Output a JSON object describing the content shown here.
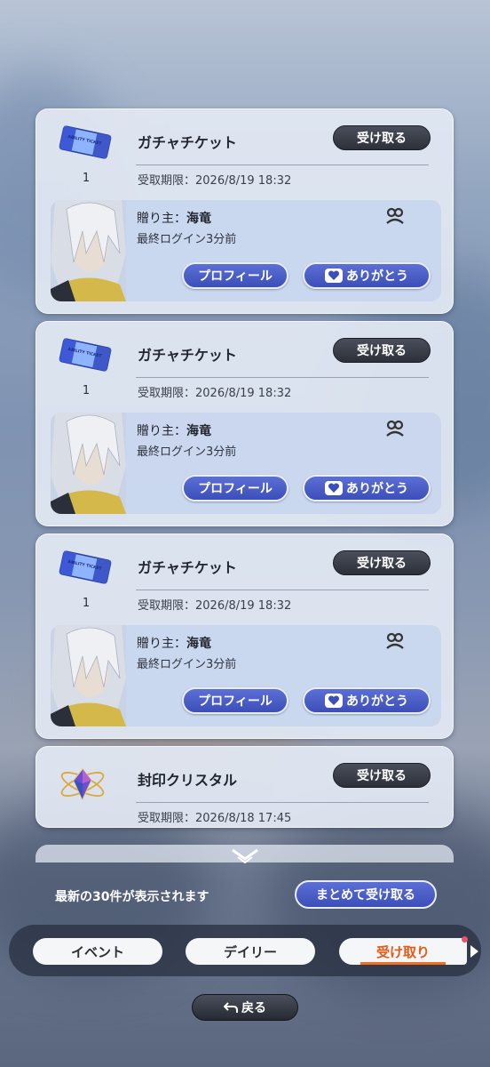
{
  "gifts": [
    {
      "name": "ガチャチケット",
      "qty": "1",
      "receive_label": "受け取る",
      "expiry": "受取期限：2026/8/19 18:32",
      "sender_prefix": "贈り主：",
      "sender_name": "海竜",
      "last_login": "最終ログイン3分前",
      "profile_label": "プロフィール",
      "thanks_label": "ありがとう",
      "ticket_text": "ABILITY TICKET"
    },
    {
      "name": "ガチャチケット",
      "qty": "1",
      "receive_label": "受け取る",
      "expiry": "受取期限：2026/8/19 18:32",
      "sender_prefix": "贈り主：",
      "sender_name": "海竜",
      "last_login": "最終ログイン3分前",
      "profile_label": "プロフィール",
      "thanks_label": "ありがとう",
      "ticket_text": "ABILITY TICKET"
    },
    {
      "name": "ガチャチケット",
      "qty": "1",
      "receive_label": "受け取る",
      "expiry": "受取期限：2026/8/19 18:32",
      "sender_prefix": "贈り主：",
      "sender_name": "海竜",
      "last_login": "最終ログイン3分前",
      "profile_label": "プロフィール",
      "thanks_label": "ありがとう",
      "ticket_text": "ABILITY TICKET"
    },
    {
      "name": "封印クリスタル",
      "receive_label": "受け取る",
      "expiry": "受取期限：2026/8/18 17:45"
    }
  ],
  "footer": {
    "notice": "最新の30件が表示されます",
    "bulk_receive_label": "まとめて受け取る"
  },
  "tabs": [
    {
      "label": "イベント"
    },
    {
      "label": "デイリー"
    },
    {
      "label": "受け取り",
      "active": true
    }
  ],
  "back_label": "戻る",
  "colors": {
    "accent_blue": "#3c4fb8",
    "active_tab": "#e85a16",
    "dark_button": "#2c3039"
  }
}
